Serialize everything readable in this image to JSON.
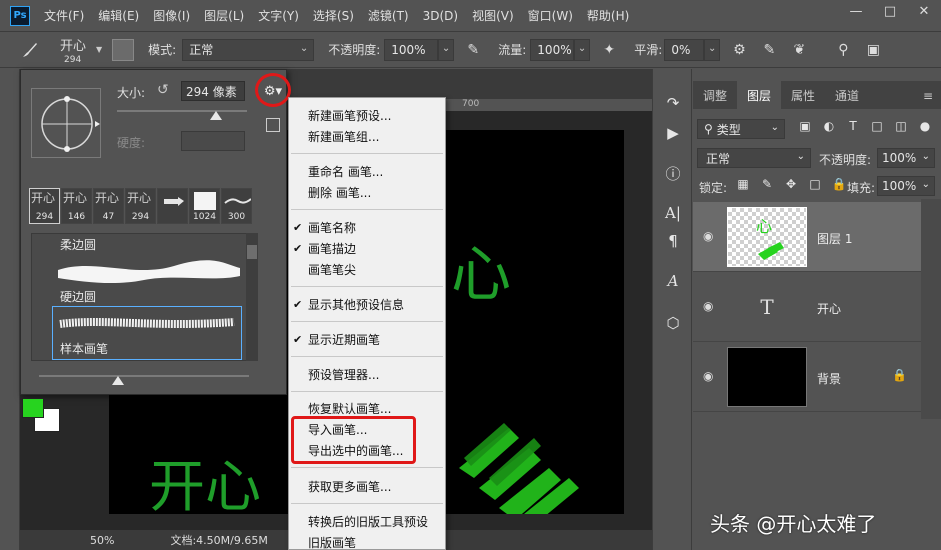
{
  "app": {
    "logo": "Ps",
    "menu": [
      "文件(F)",
      "编辑(E)",
      "图像(I)",
      "图层(L)",
      "文字(Y)",
      "选择(S)",
      "滤镜(T)",
      "3D(D)",
      "视图(V)",
      "窗口(W)",
      "帮助(H)"
    ],
    "window_controls": [
      "minimize-icon",
      "restore-icon",
      "close-icon"
    ]
  },
  "options_bar": {
    "brush_preset_glyph": "开心",
    "brush_preset_size": "294",
    "mode_label": "模式:",
    "mode_value": "正常",
    "opacity_label": "不透明度:",
    "opacity_value": "100%",
    "flow_label": "流量:",
    "flow_value": "100%",
    "smoothing_label": "平滑:",
    "smoothing_value": "0%"
  },
  "brush_popup": {
    "size_label": "大小:",
    "size_value": "294 像素",
    "hardness_label": "硬度:",
    "recent_brushes": [
      {
        "glyph": "开心",
        "size": "294"
      },
      {
        "glyph": "开心",
        "size": "146"
      },
      {
        "glyph": "开心",
        "size": "47"
      },
      {
        "glyph": "开心",
        "size": "294"
      },
      {
        "glyph": "",
        "size": ""
      },
      {
        "glyph": "",
        "size": "1024"
      },
      {
        "glyph": "",
        "size": "300"
      }
    ],
    "brush_items": [
      "柔边圆",
      "硬边圆",
      "样本画笔"
    ]
  },
  "context_menu": {
    "items": [
      {
        "label": "新建画笔预设...",
        "checked": false
      },
      {
        "label": "新建画笔组...",
        "checked": false
      },
      {
        "label": "重命名 画笔...",
        "checked": false
      },
      {
        "label": "删除 画笔...",
        "checked": false
      },
      {
        "label": "画笔名称",
        "checked": true
      },
      {
        "label": "画笔描边",
        "checked": true
      },
      {
        "label": "画笔笔尖",
        "checked": false
      },
      {
        "label": "显示其他预设信息",
        "checked": true
      },
      {
        "label": "显示近期画笔",
        "checked": true
      },
      {
        "label": "预设管理器...",
        "checked": false
      },
      {
        "label": "恢复默认画笔...",
        "checked": false
      },
      {
        "label": "导入画笔...",
        "checked": false
      },
      {
        "label": "导出选中的画笔...",
        "checked": false
      },
      {
        "label": "获取更多画笔...",
        "checked": false
      },
      {
        "label": "转换后的旧版工具预设",
        "checked": false
      },
      {
        "label": "旧版画笔",
        "checked": false
      }
    ]
  },
  "canvas": {
    "ruler_mark": "700",
    "doc_text": "心",
    "doc_text_lower": "开心",
    "zoom": "50%",
    "doc_info": "文档:4.50M/9.65M",
    "foreground_color": "#27d31f",
    "background_color": "#ffffff"
  },
  "layers_panel": {
    "tabs": [
      "调整",
      "图层",
      "属性",
      "通道"
    ],
    "active_tab": "图层",
    "filter_label": "类型",
    "blend_mode": "正常",
    "opacity_label": "不透明度:",
    "opacity_value": "100%",
    "lock_label": "锁定:",
    "fill_label": "填充:",
    "fill_value": "100%",
    "layers": [
      {
        "name": "图层 1",
        "type": "pixel",
        "selected": true
      },
      {
        "name": "开心",
        "type": "text",
        "selected": false
      },
      {
        "name": "背景",
        "type": "background",
        "selected": false,
        "locked": true
      }
    ]
  },
  "watermark": "头条 @开心太难了"
}
